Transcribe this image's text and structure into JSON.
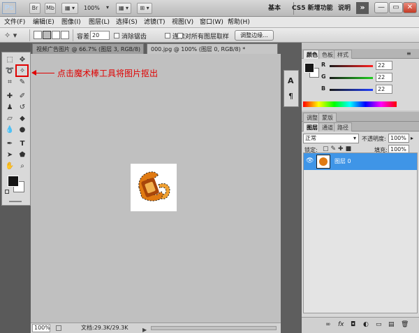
{
  "appbar": {
    "logo": "Ps",
    "buttons": [
      "Br",
      "Mb",
      "▦ ▾",
      "100%",
      "▾",
      "▦ ▾",
      "⊞ ▾"
    ],
    "zoom": "100%",
    "workspaces": [
      "基本",
      "CS5 新增功能",
      "说明"
    ],
    "more": "»",
    "window_buttons": [
      "—",
      "▭",
      "✕"
    ]
  },
  "menu": [
    "文件(F)",
    "编辑(E)",
    "图像(I)",
    "图层(L)",
    "选择(S)",
    "滤镜(T)",
    "视图(V)",
    "窗口(W)",
    "帮助(H)"
  ],
  "options": {
    "tolerance_label": "容差:",
    "tolerance_value": "20",
    "antialias": "消除锯齿",
    "contiguous": "连续",
    "sample_all": "对所有图层取样",
    "refine_edge": "调整边缘..."
  },
  "doc_tabs": [
    "视频广告图片 @ 66.7% (图层 3, RGB/8) *",
    "000.jpg @ 100% (图层 0, RGB/8) *"
  ],
  "annotation": {
    "text": "点击魔术棒工具将图片抠出",
    "accent": "#e00000"
  },
  "status": {
    "zoom": "100%",
    "doc": "文档:29.3K/29.3K"
  },
  "color_panel": {
    "tabs": [
      "颜色",
      "色板",
      "样式"
    ],
    "r_label": "R",
    "g_label": "G",
    "b_label": "B",
    "r": "22",
    "g": "22",
    "b": "22"
  },
  "adjust_tabs": [
    "调整",
    "蒙版"
  ],
  "layers_panel": {
    "tabs": [
      "图层",
      "通道",
      "路径"
    ],
    "blend_mode": "正常",
    "opacity_label": "不透明度:",
    "opacity": "100%",
    "lock_label": "锁定:",
    "fill_label": "填充:",
    "fill": "100%",
    "layer_name": "图层 0",
    "footer_icons": [
      "∞",
      "fx",
      "◘",
      "◐",
      "▭",
      "▤",
      "🗑"
    ]
  },
  "colors": {
    "selected_layer": "#3f95e7",
    "canvas_bg": "#c0c0c0",
    "foreground": "#161616",
    "background": "#ffffff"
  }
}
